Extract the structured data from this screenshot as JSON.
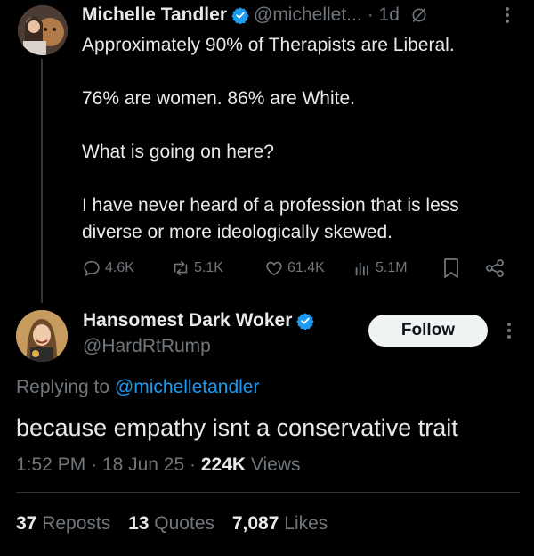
{
  "parent": {
    "name": "Michelle Tandler",
    "handle": "@michellet...",
    "time": "· 1d",
    "text": [
      "Approximately 90% of Therapists are Liberal.",
      "76% are women. 86% are White.",
      "What is going on here?",
      "I have never heard of a profession that is less diverse or more ideologically skewed."
    ],
    "actions": {
      "replies": "4.6K",
      "reposts": "5.1K",
      "likes": "61.4K",
      "views": "5.1M"
    }
  },
  "reply": {
    "name": "Hansomest Dark Woker",
    "handle": "@HardRtRump",
    "follow_label": "Follow",
    "replying_prefix": "Replying to",
    "replying_handle": "@michelletandler",
    "text": "because empathy isnt a conservative trait",
    "time": "1:52 PM",
    "date": "18 Jun 25",
    "views_count": "224K",
    "views_label": "Views",
    "stats": {
      "reposts_count": "37",
      "reposts_label": "Reposts",
      "quotes_count": "13",
      "quotes_label": "Quotes",
      "likes_count": "7,087",
      "likes_label": "Likes"
    }
  },
  "colors": {
    "background": "#000000",
    "text": "#e7e9ea",
    "secondary": "#71767b",
    "accent": "#1d9bf0"
  }
}
